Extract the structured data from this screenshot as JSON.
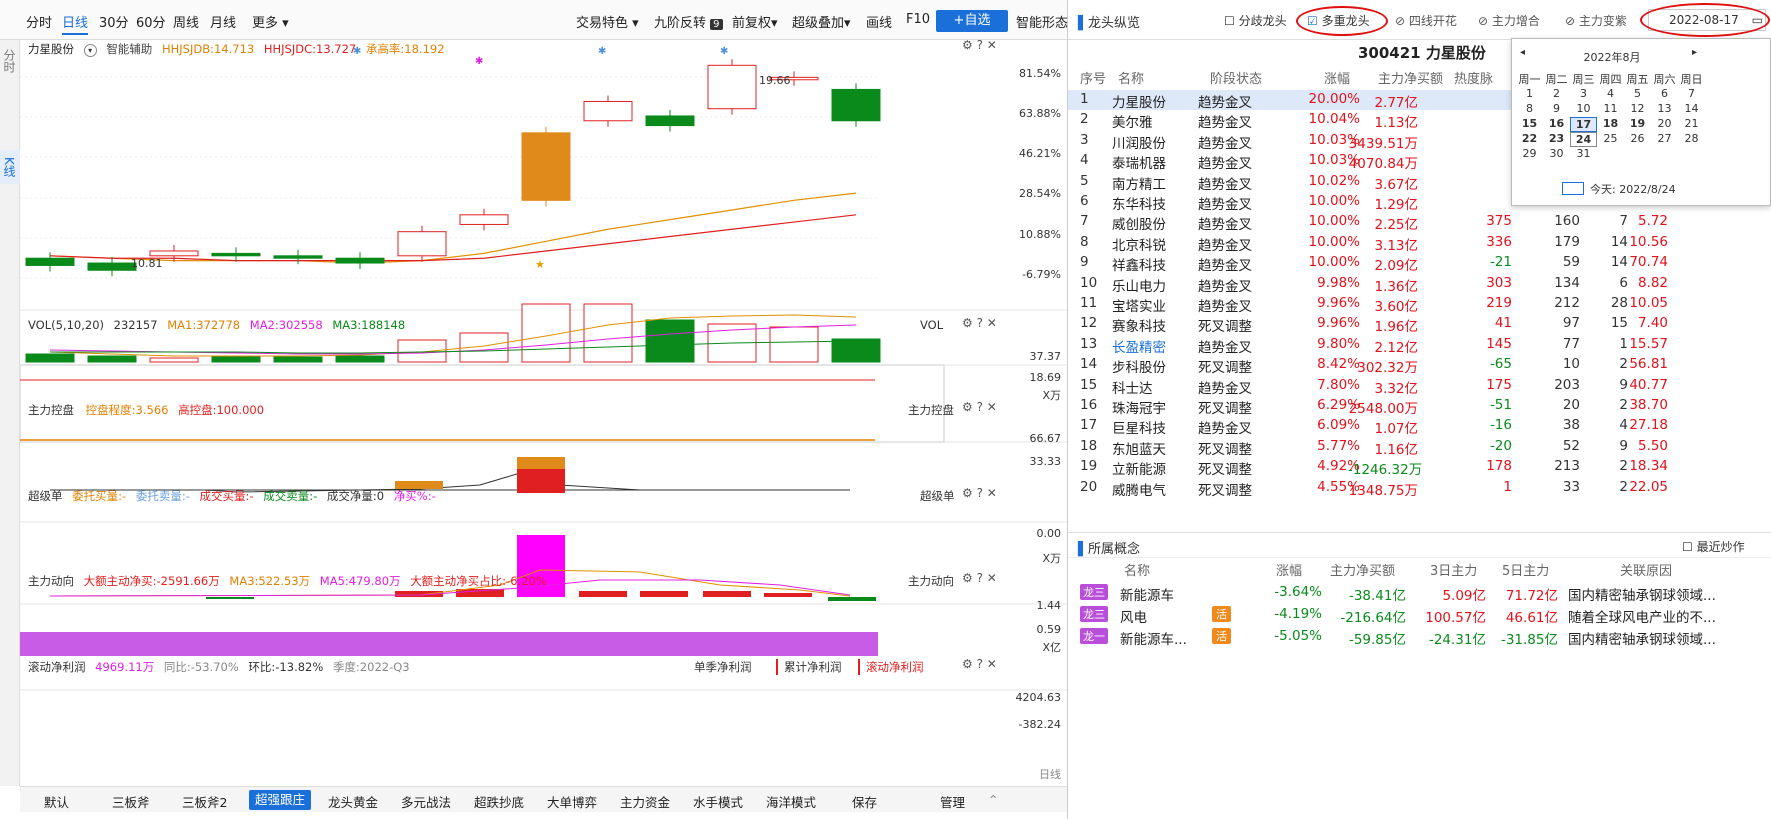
{
  "toolbar": {
    "tabs": [
      "分时",
      "日线",
      "30分",
      "60分",
      "周线",
      "月线",
      "更多"
    ],
    "active": "日线",
    "right": [
      "交易特色",
      "九阶反转",
      "前复权",
      "超级叠加",
      "画线",
      "F10"
    ],
    "badge": "9",
    "add": "+自选",
    "indicator": "智能形态"
  },
  "side_tabs": {
    "time": "分时",
    "k": "K线"
  },
  "main_panel": {
    "title": "力星股份",
    "assist": "智能辅助",
    "hh1": "HHJSJDB:14.713",
    "hh2": "HHJSJDC:13.727",
    "hh3": "承高率:18.192",
    "y_labels": [
      "81.54%",
      "63.88%",
      "46.21%",
      "28.54%",
      "10.88%",
      "-6.79%"
    ],
    "high": "19.66",
    "low": "10.81"
  },
  "vol_panel": {
    "title": "VOL(5,10,20)",
    "val": "232157",
    "ma1": "MA1:372778",
    "ma2": "MA2:302558",
    "ma3": "MA3:188148",
    "tag": "VOL",
    "y": [
      "37.37",
      "18.69"
    ],
    "unit": "X万"
  },
  "ctrl_panel": {
    "title": "主力控盘",
    "deg": "控盘程度:3.566",
    "high": "高控盘:100.000",
    "tag": "主力控盘",
    "y": [
      "66.67",
      "33.33"
    ]
  },
  "super_panel": {
    "title": "超级单",
    "items": [
      "委托买量:-",
      "委托卖量:-",
      "成交买量:-",
      "成交卖量:-",
      "成交净量:0",
      "净买%:-"
    ],
    "tag": "超级单",
    "y": [
      "0.00"
    ],
    "unit": "X万"
  },
  "flow_panel": {
    "title": "主力动向",
    "a": "大额主动净买:-2591.66万",
    "b": "MA3:522.53万",
    "c": "MA5:479.80万",
    "d": "大额主动净买占比:-6.20%",
    "tag": "主力动向",
    "y": [
      "1.44",
      "0.59"
    ],
    "unit": "X亿"
  },
  "profit_panel": {
    "title": "滚动净利润",
    "val": "4969.11万",
    "yoy": "同比:-53.70%",
    "qoq": "环比:-13.82%",
    "season": "季度:2022-Q3",
    "btns": [
      "单季净利润",
      "累计净利润",
      "滚动净利润"
    ],
    "y": [
      "4204.63",
      "-382.24"
    ]
  },
  "day_label": "日线",
  "bottom_tabs": [
    "默认",
    "三板斧",
    "三板斧2",
    "超强跟庄",
    "龙头黄金",
    "多元战法",
    "超跌抄底",
    "大单博弈",
    "主力资金",
    "水手模式",
    "海洋模式",
    "保存",
    "管理"
  ],
  "bottom_active": "超强跟庄",
  "chart_data": {
    "type": "candlestick",
    "candles": [
      {
        "o": 1,
        "c": -2
      },
      {
        "o": -1,
        "c": -4
      },
      {
        "o": 2,
        "c": 4
      },
      {
        "o": 3,
        "c": 2
      },
      {
        "o": 2,
        "c": 1
      },
      {
        "o": 1,
        "c": -1
      },
      {
        "o": 2,
        "c": 12
      },
      {
        "o": 15,
        "c": 19
      },
      {
        "o": 25,
        "c": 53
      },
      {
        "o": 58,
        "c": 66
      },
      {
        "o": 60,
        "c": 56
      },
      {
        "o": 63,
        "c": 81
      },
      {
        "o": 75,
        "c": 76
      },
      {
        "o": 71,
        "c": 58
      }
    ],
    "volume": [
      8,
      6,
      4,
      5,
      5,
      6,
      22,
      29,
      58,
      58,
      42,
      38,
      35,
      23
    ]
  },
  "right": {
    "title": "龙头纵览",
    "checks": [
      "分歧龙头",
      "多重龙头",
      "四线开花",
      "主力增合",
      "主力变紫"
    ],
    "date": "2022-08-17",
    "stock_head": "300421 力星股份",
    "headers": [
      "序号",
      "名称",
      "阶段状态",
      "涨幅",
      "主力净买额",
      "热度脉"
    ],
    "rows": [
      [
        "1",
        "力星股份",
        "趋势金叉",
        "20.00%",
        "2.77亿"
      ],
      [
        "2",
        "美尔雅",
        "趋势金叉",
        "10.04%",
        "1.13亿"
      ],
      [
        "3",
        "川润股份",
        "趋势金叉",
        "10.03%",
        "3439.51万"
      ],
      [
        "4",
        "泰瑞机器",
        "趋势金叉",
        "10.03%",
        "4070.84万"
      ],
      [
        "5",
        "南方精工",
        "趋势金叉",
        "10.02%",
        "3.67亿"
      ],
      [
        "6",
        "东华科技",
        "趋势金叉",
        "10.00%",
        "1.29亿"
      ],
      [
        "7",
        "威创股份",
        "趋势金叉",
        "10.00%",
        "2.25亿"
      ],
      [
        "8",
        "北京科锐",
        "趋势金叉",
        "10.00%",
        "3.13亿"
      ],
      [
        "9",
        "祥鑫科技",
        "趋势金叉",
        "10.00%",
        "2.09亿"
      ],
      [
        "10",
        "乐山电力",
        "趋势金叉",
        "9.98%",
        "1.36亿"
      ],
      [
        "11",
        "宝塔实业",
        "趋势金叉",
        "9.96%",
        "3.60亿"
      ],
      [
        "12",
        "赛象科技",
        "死叉调整",
        "9.96%",
        "1.96亿"
      ],
      [
        "13",
        "长盈精密",
        "趋势金叉",
        "9.80%",
        "2.12亿"
      ],
      [
        "14",
        "步科股份",
        "死叉调整",
        "8.42%",
        "302.32万"
      ],
      [
        "15",
        "科士达",
        "趋势金叉",
        "7.80%",
        "3.32亿"
      ],
      [
        "16",
        "珠海冠宇",
        "死叉调整",
        "6.29%",
        "2548.00万"
      ],
      [
        "17",
        "巨星科技",
        "趋势金叉",
        "6.09%",
        "1.07亿"
      ],
      [
        "18",
        "东旭蓝天",
        "死叉调整",
        "5.77%",
        "1.16亿"
      ],
      [
        "19",
        "立新能源",
        "死叉调整",
        "4.92%",
        "-1246.32万"
      ],
      [
        "20",
        "威腾电气",
        "死叉调整",
        "4.55%",
        "1348.75万"
      ]
    ],
    "extra": [
      [
        "",
        "",
        "",
        ""
      ],
      [
        "",
        "",
        "",
        ""
      ],
      [
        "",
        "",
        "",
        ""
      ],
      [
        "",
        "",
        "",
        ""
      ],
      [
        "",
        "",
        "",
        ""
      ],
      [
        "",
        "",
        "",
        ""
      ],
      [
        "375",
        "160",
        "7",
        "5.72"
      ],
      [
        "336",
        "179",
        "14",
        "10.56"
      ],
      [
        "-21",
        "59",
        "14",
        "70.74"
      ],
      [
        "303",
        "134",
        "6",
        "8.82"
      ],
      [
        "219",
        "212",
        "28",
        "10.05"
      ],
      [
        "41",
        "97",
        "15",
        "7.40"
      ],
      [
        "145",
        "77",
        "1",
        "15.57"
      ],
      [
        "-65",
        "10",
        "2",
        "56.81"
      ],
      [
        "175",
        "203",
        "9",
        "40.77"
      ],
      [
        "-51",
        "20",
        "2",
        "38.70"
      ],
      [
        "-16",
        "38",
        "4",
        "27.18"
      ],
      [
        "-20",
        "52",
        "9",
        "5.50"
      ],
      [
        "178",
        "213",
        "2",
        "18.34"
      ],
      [
        "1",
        "33",
        "2",
        "22.05"
      ]
    ],
    "calendar": {
      "title": "2022年8月",
      "week": [
        "周一",
        "周二",
        "周三",
        "周四",
        "周五",
        "周六",
        "周日"
      ],
      "days": [
        [
          "1",
          "2",
          "3",
          "4",
          "5",
          "6",
          "7"
        ],
        [
          "8",
          "9",
          "10",
          "11",
          "12",
          "13",
          "14"
        ],
        [
          "15",
          "16",
          "17",
          "18",
          "19",
          "20",
          "21"
        ],
        [
          "22",
          "23",
          "24",
          "25",
          "26",
          "27",
          "28"
        ],
        [
          "29",
          "30",
          "31",
          "",
          "",
          "",
          ""
        ]
      ],
      "today": "今天: 2022/8/24"
    },
    "concept": {
      "title": "所属概念",
      "check": "最近炒作",
      "headers": [
        "名称",
        "涨幅",
        "主力净买额",
        "3日主力",
        "5日主力",
        "关联原因"
      ],
      "rows": [
        {
          "tag": "龙三",
          "name": "新能源车",
          "hot": "",
          "chg": "-3.64%",
          "net": "-38.41亿",
          "d3": "5.09亿",
          "d5": "71.72亿",
          "reason": "国内精密轴承钢球领域..."
        },
        {
          "tag": "龙三",
          "name": "风电",
          "hot": "活",
          "chg": "-4.19%",
          "net": "-216.64亿",
          "d3": "100.57亿",
          "d5": "46.61亿",
          "reason": "随着全球风电产业的不..."
        },
        {
          "tag": "龙一",
          "name": "新能源车...",
          "hot": "活",
          "chg": "-5.05%",
          "net": "-59.85亿",
          "d3": "-24.31亿",
          "d5": "-31.85亿",
          "reason": "国内精密轴承钢球领域..."
        }
      ]
    }
  }
}
